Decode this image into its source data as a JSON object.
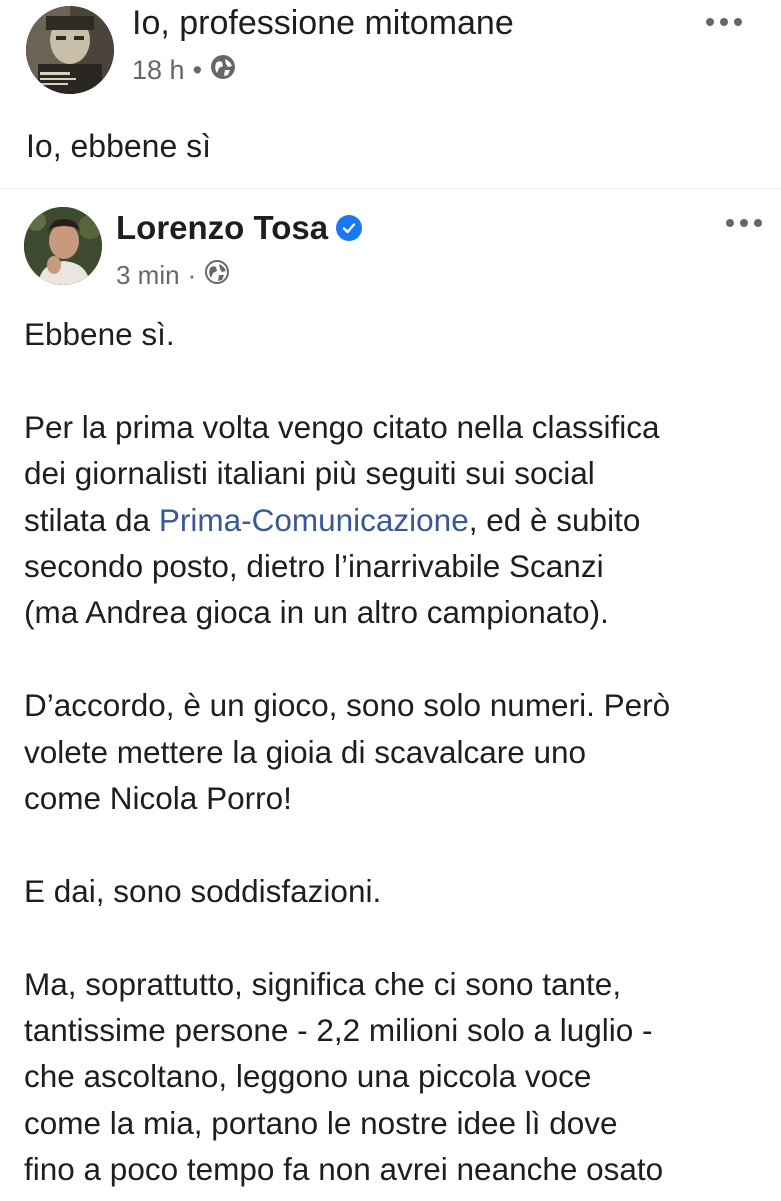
{
  "outer_post": {
    "author": "Io, professione mitomane",
    "time": "18 h",
    "separator": "•",
    "privacy_icon": "globe-icon",
    "text": "Io, ebbene sì"
  },
  "shared_post": {
    "author": "Lorenzo Tosa",
    "verified_icon": "verified-badge-icon",
    "time": "3 min",
    "separator": "·",
    "privacy_icon": "globe-icon",
    "paragraphs": [
      {
        "lines": [
          "Ebbene sì."
        ]
      },
      {
        "lines": [
          "Per la prima volta vengo citato nella classifica",
          "dei giornalisti italiani più seguiti sui social"
        ],
        "line3_pre": "stilata da ",
        "line3_link": "Prima-Comunicazione",
        "line3_post": ", ed è subito",
        "lines_after": [
          "secondo posto, dietro l’inarrivabile Scanzi",
          "(ma Andrea gioca in un altro campionato)."
        ]
      },
      {
        "lines": [
          "D’accordo, è un gioco, sono solo numeri. Però",
          "volete mettere la gioia di scavalcare uno",
          "come Nicola Porro!"
        ]
      },
      {
        "lines": [
          "E dai, sono soddisfazioni."
        ]
      },
      {
        "lines": [
          "Ma, soprattutto, significa che ci sono tante,",
          "tantissime persone - 2,2 milioni solo a luglio -",
          "che ascoltano, leggono una piccola voce",
          "come la mia, portano le nostre idee lì dove",
          "fino a poco tempo fa non avrei neanche osato"
        ]
      }
    ]
  },
  "colors": {
    "text": "#1c1e21",
    "meta": "#65676b",
    "link": "#385898",
    "verified": "#1877f2"
  }
}
